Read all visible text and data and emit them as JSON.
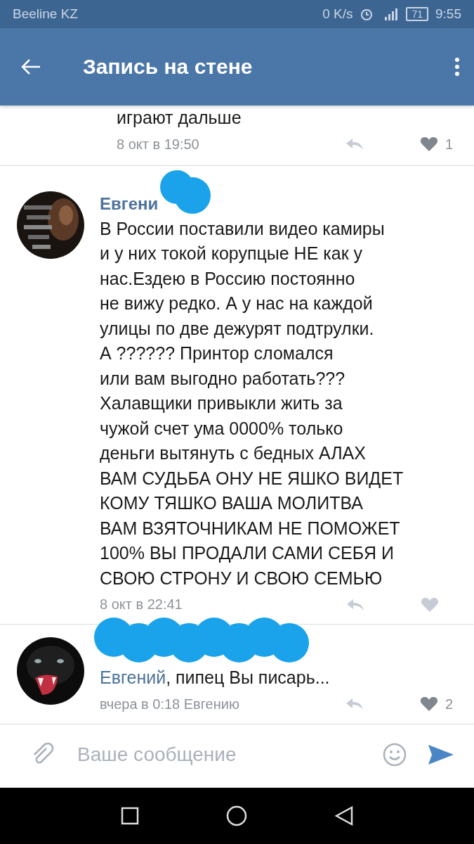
{
  "status_bar": {
    "carrier": "Beeline KZ",
    "speed": "0 K/s",
    "battery": "71",
    "time": "9:55"
  },
  "app_bar": {
    "title": "Запись на стене"
  },
  "comments": [
    {
      "kind": "tail",
      "text": "играют дальше",
      "date": "8 окт в 19:50",
      "likes": "1"
    },
    {
      "kind": "full",
      "author": "Евгени",
      "redacted": true,
      "text": "В России поставили видео камиры\nи у них токой корупцые НЕ как у\nнас.Ездею в Россию постоянно\nне вижу редко. А у нас на каждой\nулицы по две дежурят подтрулки.\nА ?????? Принтор сломался\nили вам выгодно работать???\nХалавщики привыкли жить за\nчужой счет ума 0000%  только\nденьги вытянуть с бедных АЛАХ\nВАМ СУДЬБА ОНУ НЕ ЯШКО ВИДЕТ\nКОМУ ТЯШКО ВАША МОЛИТВА\nВАМ ВЗЯТОЧНИКАМ НЕ ПОМОЖЕТ\n100% ВЫ ПРОДАЛИ САМИ СЕБЯ И\nСВОЮ СТРОНУ И СВОЮ СЕМЬЮ",
      "date": "8 окт в 22:41"
    },
    {
      "kind": "reply",
      "redacted": true,
      "reply_to": "Евгений",
      "text": ", пипец Вы писарь...",
      "date": "вчера в 0:18 Евгению",
      "likes": "2"
    }
  ],
  "composer": {
    "placeholder": "Ваше сообщение"
  }
}
